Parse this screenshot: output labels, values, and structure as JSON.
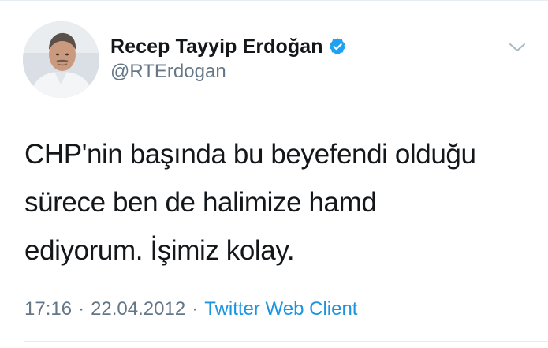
{
  "tweet": {
    "author": {
      "display_name": "Recep Tayyip Erdoğan",
      "handle": "@RTErdogan",
      "verified": true
    },
    "text": "CHP'nin başında bu beyefendi olduğu\nsürece ben de halimize hamd\nediyorum. İşimiz kolay.",
    "meta": {
      "time": "17:16",
      "separator_1": "·",
      "date": "22.04.2012",
      "separator_2": "·",
      "source": "Twitter Web Client"
    }
  },
  "icons": {
    "verified": "verified-badge-icon",
    "menu": "chevron-down-icon"
  },
  "colors": {
    "text_primary": "#14171a",
    "text_secondary": "#657786",
    "link": "#1b95e0",
    "verified": "#1da1f2",
    "divider": "#e6ecf0"
  }
}
